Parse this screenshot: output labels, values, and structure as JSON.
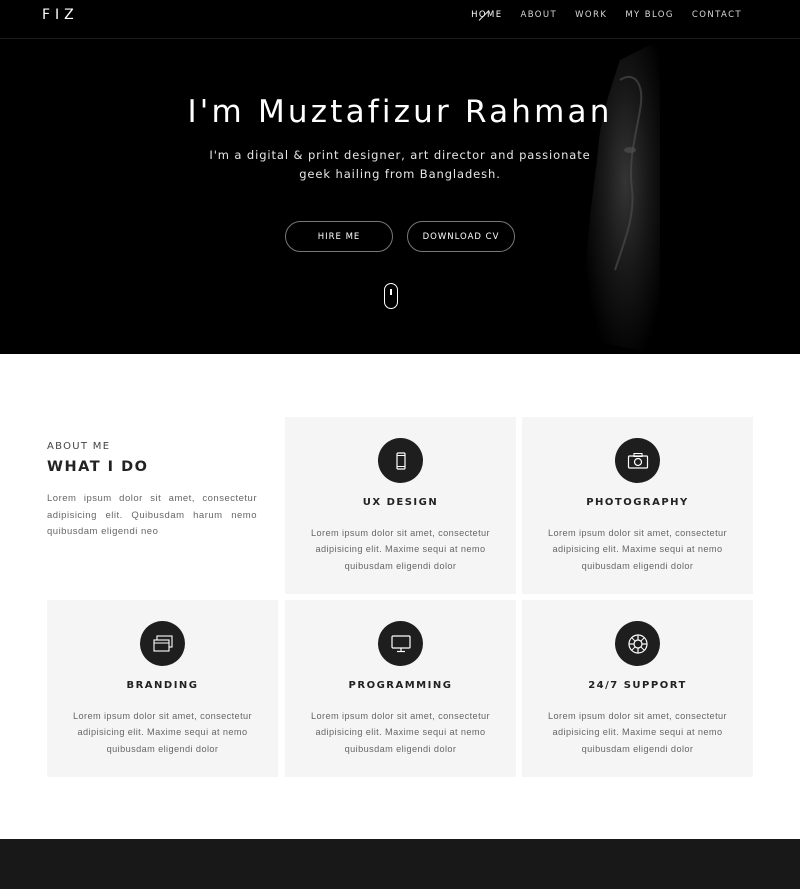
{
  "header": {
    "logo": "FIZ",
    "nav": [
      "HOME",
      "ABOUT",
      "WORK",
      "MY BLOG",
      "CONTACT"
    ]
  },
  "hero": {
    "title": "I'm Muztafizur Rahman",
    "subtitle": "I'm a digital & print designer, art director and passionate geek hailing from Bangladesh.",
    "hire_label": "HIRE ME",
    "cv_label": "DOWNLOAD CV"
  },
  "about": {
    "label": "ABOUT ME",
    "heading": "WHAT I DO",
    "text": "Lorem ipsum dolor sit amet, consectetur adipisicing elit. Quibusdam harum nemo quibusdam eligendi neo"
  },
  "services": [
    {
      "title": "UX DESIGN",
      "icon": "mobile-icon",
      "text": "Lorem ipsum dolor sit amet, consectetur adipisicing elit. Maxime sequi at nemo quibusdam eligendi dolor"
    },
    {
      "title": "PHOTOGRAPHY",
      "icon": "camera-icon",
      "text": "Lorem ipsum dolor sit amet, consectetur adipisicing elit. Maxime sequi at nemo quibusdam eligendi dolor"
    },
    {
      "title": "BRANDING",
      "icon": "windows-icon",
      "text": "Lorem ipsum dolor sit amet, consectetur adipisicing elit. Maxime sequi at nemo quibusdam eligendi dolor"
    },
    {
      "title": "PROGRAMMING",
      "icon": "monitor-icon",
      "text": "Lorem ipsum dolor sit amet, consectetur adipisicing elit. Maxime sequi at nemo quibusdam eligendi dolor"
    },
    {
      "title": "24/7 SUPPORT",
      "icon": "lifebuoy-icon",
      "text": "Lorem ipsum dolor sit amet, consectetur adipisicing elit. Maxime sequi at nemo quibusdam eligendi dolor"
    }
  ],
  "colors": {
    "hero_bg": "#000000",
    "card_bg": "#f5f5f5",
    "icon_bg": "#1e1e1e",
    "footer_bg": "#181818"
  }
}
